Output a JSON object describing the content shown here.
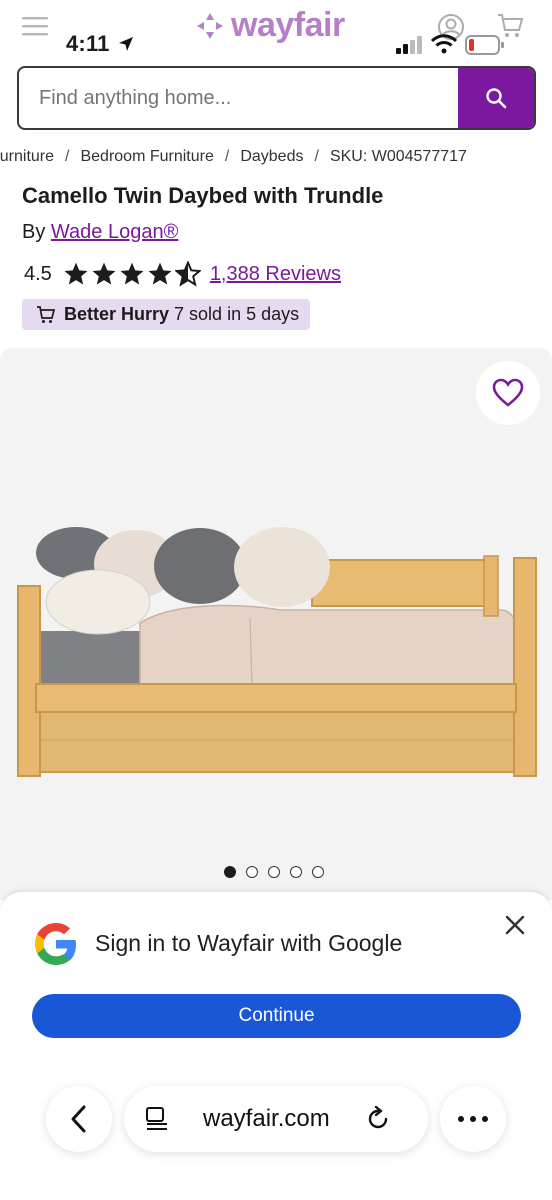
{
  "status_bar": {
    "time": "4:11"
  },
  "header": {
    "logo_text": "wayfair"
  },
  "search": {
    "placeholder": "Find anything home..."
  },
  "breadcrumb": {
    "items": [
      "Furniture",
      "Bedroom Furniture",
      "Daybeds"
    ],
    "sku": "SKU: W004577717"
  },
  "product": {
    "title": "Camello Twin Daybed with Trundle",
    "by_label": "By",
    "brand": "Wade Logan®",
    "rating": "4.5",
    "stars_value": 4.5,
    "stars_max": 5,
    "reviews": "1,388 Reviews",
    "hurry_label": "Better Hurry",
    "hurry_text": "7 sold in 5 days",
    "image_count": 5,
    "active_image": 1
  },
  "google_prompt": {
    "title": "Sign in to Wayfair with Google",
    "continue_label": "Continue"
  },
  "browser": {
    "url": "wayfair.com"
  },
  "colors": {
    "brand_purple": "#7b189f",
    "badge_bg": "#e6daf0",
    "google_blue": "#1a57d6"
  },
  "icons": [
    "menu-icon",
    "account-icon",
    "cart-icon",
    "search-icon",
    "star-icon",
    "shopping-cart-icon",
    "heart-icon",
    "google-icon",
    "close-icon",
    "back-icon",
    "reader-icon",
    "reload-icon",
    "more-icon",
    "location-arrow-icon",
    "signal-icon",
    "wifi-icon",
    "battery-icon"
  ]
}
